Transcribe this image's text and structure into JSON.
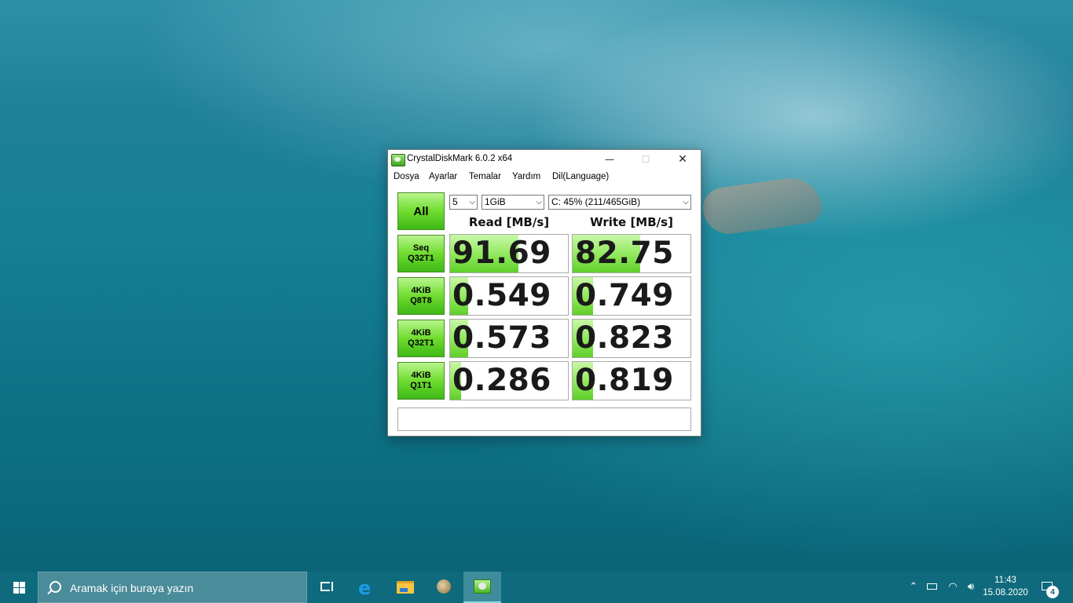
{
  "window": {
    "title": "CrystalDiskMark 6.0.2 x64",
    "min_glyph": "—",
    "max_glyph": "☐",
    "close_glyph": "✕"
  },
  "menu": [
    "Dosya",
    "Ayarlar",
    "Temalar",
    "Yardım",
    "Dil(Language)"
  ],
  "controls": {
    "all_label": "All",
    "count_value": "5",
    "size_value": "1GiB",
    "drive_value": "C: 45% (211/465GiB)",
    "chevron_glyph": "⌵"
  },
  "headers": {
    "read": "Read [MB/s]",
    "write": "Write [MB/s]"
  },
  "tests": [
    {
      "line1": "Seq",
      "line2": "Q32T1",
      "read": "91.69",
      "write": "82.75",
      "read_fill": 0.58,
      "write_fill": 0.57
    },
    {
      "line1": "4KiB",
      "line2": "Q8T8",
      "read": "0.549",
      "write": "0.749",
      "read_fill": 0.15,
      "write_fill": 0.17
    },
    {
      "line1": "4KiB",
      "line2": "Q32T1",
      "read": "0.573",
      "write": "0.823",
      "read_fill": 0.15,
      "write_fill": 0.17
    },
    {
      "line1": "4KiB",
      "line2": "Q1T1",
      "read": "0.286",
      "write": "0.819",
      "read_fill": 0.09,
      "write_fill": 0.17
    }
  ],
  "comment": "",
  "taskbar": {
    "search_placeholder": "Aramak için buraya yazın",
    "edge_glyph": "e",
    "tray_chevron": "⌃",
    "tray_network": "◠",
    "tray_volume": "🔊︎",
    "time": "11:43",
    "date": "15.08.2020",
    "notification_count": "4"
  },
  "colors": {
    "accent_green": "#6fdc2f",
    "bar_green": "#8fe85a",
    "taskbar": "#0e6a7c"
  }
}
